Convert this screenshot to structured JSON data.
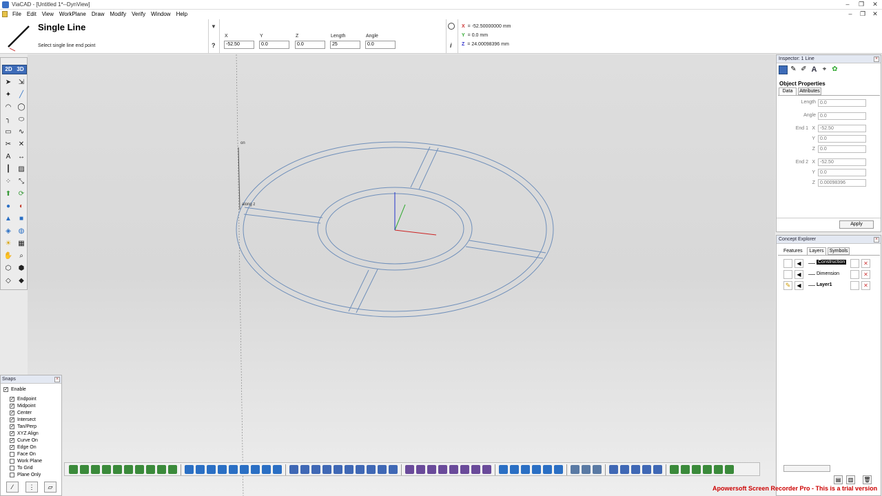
{
  "window": {
    "title": "ViaCAD - [Untitled 1*--DynView]"
  },
  "menu": {
    "items": [
      "File",
      "Edit",
      "View",
      "WorkPlane",
      "Draw",
      "Modify",
      "Verify",
      "Window",
      "Help"
    ]
  },
  "tool": {
    "name": "Single Line",
    "prompt": "Select single line end point",
    "help_glyph": "?",
    "fields": [
      {
        "label": "X",
        "value": "-52.50"
      },
      {
        "label": "Y",
        "value": "0.0"
      },
      {
        "label": "Z",
        "value": "0.0"
      },
      {
        "label": "Length",
        "value": "25"
      },
      {
        "label": "Angle",
        "value": "0.0"
      }
    ],
    "info_glyph": "i"
  },
  "readout": {
    "x_label": "X",
    "x_value": "= -52.50000000 mm",
    "y_label": "Y",
    "y_value": "= 0.0 mm",
    "z_label": "Z",
    "z_value": "= 24.00098396 mm"
  },
  "viewport": {
    "label_on": "on",
    "label_along_z": "along z",
    "axis_colors": {
      "x": "#cc2222",
      "y": "#33aa33",
      "z": "#2233cc"
    },
    "geometry_color": "#6f8fba"
  },
  "toolbox": {
    "mode_2d": "2D",
    "mode_3d": "3D",
    "icons": [
      "select-arrow-icon",
      "select-pointer-icon",
      "point-icon",
      "line-icon",
      "arc-icon",
      "circle-icon",
      "fillet-icon",
      "ellipse-icon",
      "rectangle-icon",
      "spline-icon",
      "trim-icon",
      "delete-cross-icon",
      "text-icon",
      "dimension-icon",
      "construction-icon",
      "hatch-icon",
      "pattern-icon",
      "transform-icon",
      "solid-extrude-icon",
      "solid-revolve-icon",
      "sphere-icon",
      "blend-icon",
      "cone-icon",
      "box-icon",
      "shell-icon",
      "boolean-icon",
      "light-icon",
      "render-icon",
      "pan-hand-icon",
      "zoom-icon",
      "view-iso-icon",
      "view-top-icon",
      "view-front-icon",
      "view-right-icon"
    ]
  },
  "snaps": {
    "title": "Snaps",
    "enable_label": "Enable",
    "enable_checked": true,
    "items": [
      {
        "label": "Endpoint",
        "checked": true
      },
      {
        "label": "Midpoint",
        "checked": true
      },
      {
        "label": "Center",
        "checked": true
      },
      {
        "label": "Intersect",
        "checked": true
      },
      {
        "label": "Tan/Perp",
        "checked": true
      },
      {
        "label": "XYZ Align",
        "checked": true
      },
      {
        "label": "Curve On",
        "checked": true
      },
      {
        "label": "Edge On",
        "checked": true
      },
      {
        "label": "Face On",
        "checked": false
      },
      {
        "label": "Work Plane",
        "checked": false
      },
      {
        "label": "To Grid",
        "checked": false
      },
      {
        "label": "Plane Only",
        "checked": false
      }
    ]
  },
  "inspector": {
    "title": "Inspector: 1 Line",
    "section": "Object Properties",
    "tabs": [
      "Data",
      "Attributes"
    ],
    "length_label": "Length",
    "length_value": "0.0",
    "angle_label": "Angle",
    "angle_value": "0.0",
    "end1_label": "End 1",
    "end2_label": "End 2",
    "x_label": "X",
    "y_label": "Y",
    "z_label": "Z",
    "end1": {
      "x": "-52.50",
      "y": "0.0",
      "z": "0.0"
    },
    "end2": {
      "x": "-52.50",
      "y": "0.0",
      "z": "0.00098396"
    },
    "apply_label": "Apply"
  },
  "concept": {
    "title": "Concept Explorer",
    "tabs": [
      "Features",
      "Layers",
      "Symbols"
    ],
    "layers": [
      {
        "name": "Construction",
        "selected": true
      },
      {
        "name": "Dimension",
        "selected": false
      },
      {
        "name": "Layer1",
        "selected": false
      }
    ]
  },
  "watermark": "Apowersoft Screen Recorder Pro - This is a trial version"
}
